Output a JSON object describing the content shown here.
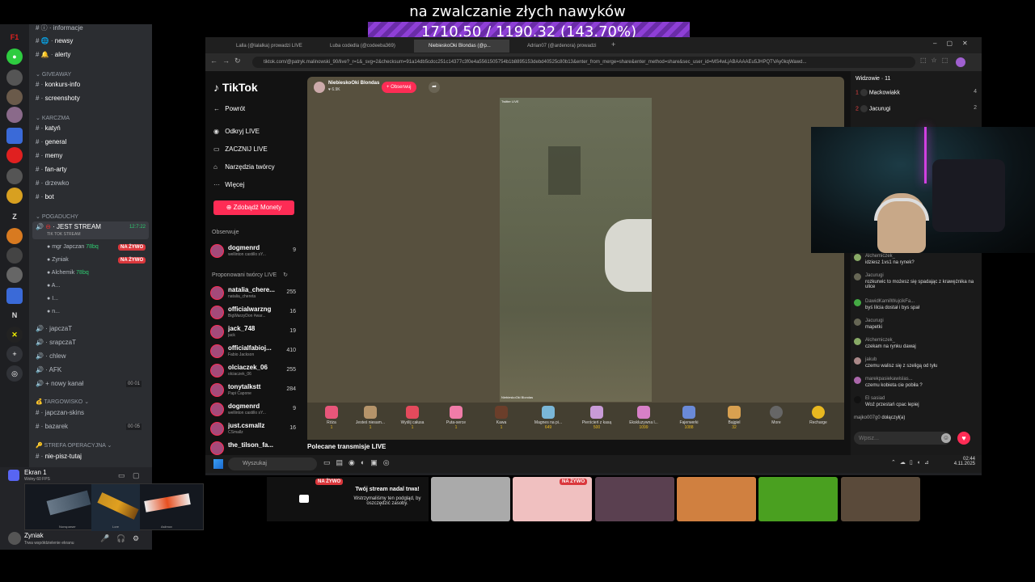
{
  "overlay": {
    "title": "na zwalczanie złych nawyków",
    "progress_text": "1710.50 / 1190.32 (143.70%)",
    "progress_percent": 143.7
  },
  "discord": {
    "channels": [
      {
        "name": "informacje",
        "icon": "info-icon"
      },
      {
        "name": "newsy",
        "icon": "globe-icon"
      },
      {
        "name": "alerty",
        "icon": "bell-icon"
      }
    ],
    "cat_giveaway": "GIVEAWAY",
    "giveaway_channels": [
      "konkurs-info",
      "screenshoty"
    ],
    "cat_karczma": "KARCZMA",
    "karczma_channels": [
      "katyń",
      "general",
      "memy",
      "fan-arty",
      "drzewko",
      "bot"
    ],
    "cat_pogaduchy": "POGADUCHY",
    "live_channel": "JEST STREAM",
    "live_channel_sub": "TIK TOK STREAM",
    "live_timer": "12:7:22",
    "live_users": [
      {
        "name": "mgr Japczan",
        "badge": "78bq",
        "live": "NA ŻYWO"
      },
      {
        "name": "Zyniak",
        "badge": "",
        "live": "NA ŻYWO"
      },
      {
        "name": "Alchemik",
        "badge": "78bq",
        "live": ""
      },
      {
        "name": "A...",
        "badge": "",
        "live": ""
      },
      {
        "name": "I...",
        "badge": "",
        "live": ""
      },
      {
        "name": "n...",
        "badge": "",
        "live": ""
      }
    ],
    "voice_channels": [
      {
        "name": "japczaT",
        "count": ""
      },
      {
        "name": "srapczaT",
        "count": ""
      },
      {
        "name": "chlew",
        "count": ""
      },
      {
        "name": "AFK",
        "count": ""
      },
      {
        "name": "nowy kanał",
        "count": "00 01"
      }
    ],
    "cat_targowisko": "TARGOWISKO",
    "targ_channels": [
      {
        "name": "japczan-skins",
        "count": ""
      },
      {
        "name": "bazarek",
        "count": "00 05"
      }
    ],
    "cat_strefa": "STREFA OPERACYJNA",
    "strefa_channels": [
      "nie-pisz-tutaj"
    ],
    "screen_share_title": "Ekran 1",
    "screen_share_sub": "Wolny 60 FPS",
    "skins": [
      "Nonsparser",
      "Lore",
      "Asiimov"
    ],
    "user_name": "Zyniak",
    "user_status": "Trwa współdzielenie ekranu",
    "server_letters": [
      "Z",
      "N"
    ]
  },
  "browser": {
    "tabs": [
      "Lalla (@lalalka) prowadzi LIVE",
      "Luba codedla (@codeeba369)",
      "NiebieskoOki Blondas (@p...",
      "Adrian07 (@ardenora) prowadzi"
    ],
    "url": "tiktok.com/@patryk.malinowski_90/live?_r=1&_svg=2&checksum=91a14db5cdcc251c14377c3f0e4a5561505754b1b8895153debd40525c80b13&enter_from_merge=share&enter_method=share&sec_user_id=MS4wLjABAAAAEu5JHPQTVAy0kqWawd..."
  },
  "tiktok": {
    "logo": "TikTok",
    "nav": [
      {
        "label": "Powrót",
        "icon": "arrow-left-icon"
      },
      {
        "label": "Odkryj LIVE",
        "icon": "live-icon"
      },
      {
        "label": "ZACZNIJ LIVE",
        "icon": "camera-icon"
      },
      {
        "label": "Narzędzia twórcy",
        "icon": "home-icon"
      },
      {
        "label": "Więcej",
        "icon": "more-icon"
      }
    ],
    "coins_button": "Zdobądź Monety",
    "following_title": "Obserwuje",
    "following": [
      {
        "name": "dogmenrd",
        "sub": "wellinton castillo sY...",
        "count": "9"
      }
    ],
    "suggested_title": "Proponowani twórcy LIVE",
    "suggested": [
      {
        "name": "natalia_chere...",
        "sub": "natalia_chereta",
        "count": "255"
      },
      {
        "name": "officialwarzng",
        "sub": "BigWarzyDon #war...",
        "count": "16"
      },
      {
        "name": "jack_748",
        "sub": "jack",
        "count": "19"
      },
      {
        "name": "officialfabioj...",
        "sub": "Fabio Jackson",
        "count": "410"
      },
      {
        "name": "olciaczek_06",
        "sub": "olciaczek_06",
        "count": "255"
      },
      {
        "name": "tonytalkstt",
        "sub": "Papi Capone",
        "count": "284"
      },
      {
        "name": "dogmenrd",
        "sub": "wellinton castillo sY...",
        "count": "9"
      },
      {
        "name": "just.csmallz",
        "sub": "CSmallz",
        "count": "16"
      },
      {
        "name": "the_tilson_fa...",
        "sub": "",
        "count": ""
      }
    ],
    "host_name": "NiebieskoOki Blondas",
    "host_likes": "6.9K",
    "follow_button": "+ Obserwuj",
    "video_tag_top": "Twitter LIVE",
    "video_tag_bottom": "NiebieskoOki Blondas",
    "gifts": [
      {
        "name": "Róża",
        "price": "1",
        "color": "#e8567a"
      },
      {
        "name": "Jesteś niesam...",
        "price": "1",
        "color": "#b5946a"
      },
      {
        "name": "Wyślij całusa",
        "price": "1",
        "color": "#e44a5c"
      },
      {
        "name": "Puta-serce",
        "price": "1",
        "color": "#f07ca8"
      },
      {
        "name": "Kawa",
        "price": "1",
        "color": "#6b3e2a"
      },
      {
        "name": "Magnes na pi...",
        "price": "649",
        "color": "#7ab7d8"
      },
      {
        "name": "Pierścień z kasą",
        "price": "500",
        "color": "#c99bd8"
      },
      {
        "name": "Ekskluzywna l...",
        "price": "1099",
        "color": "#d880c8"
      },
      {
        "name": "Fajerwerki",
        "price": "1088",
        "color": "#6a8ad8"
      },
      {
        "name": "Bajgiel",
        "price": "32",
        "color": "#d8a050"
      },
      {
        "name": "More",
        "price": "",
        "color": "#666"
      },
      {
        "name": "Recharge",
        "price": "",
        "color": "#e8b820"
      }
    ],
    "recommended_title": "Polecane transmisje LIVE",
    "viewers_title": "Widzowie · 11",
    "viewers": [
      {
        "rank": "1",
        "name": "Mackowiakk",
        "score": "4"
      },
      {
        "rank": "2",
        "name": "Jacurugi",
        "score": "2"
      }
    ],
    "chat": [
      {
        "name": "Alchemiczek_",
        "text": "idziesz 1vs1 na rynek?"
      },
      {
        "name": "Jacurugi",
        "text": "rozkurwic to możesz się spadając z krawężnika na ulice"
      },
      {
        "name": "DawidKamilWujcikFa...",
        "text": "byś lilcia dostał i bys spał"
      },
      {
        "name": "Jacurugi",
        "text": "mapetki"
      },
      {
        "name": "Alchemiczek_",
        "text": "czekam na rynku dawaj"
      },
      {
        "name": "jakub",
        "text": "czemu walisz się z szeligą od tyłu"
      },
      {
        "name": "marekpasiekawislas...",
        "text": "czemu kobieta cie pobiła ?"
      },
      {
        "name": "El sasiad",
        "text": "Woź przestań cpac lepiej"
      },
      {
        "name": "majko007g0",
        "text": "dołączył(a)"
      }
    ],
    "chat_placeholder": "Wpisz..."
  },
  "taskbar": {
    "search": "Wyszukaj",
    "time": "02:44",
    "date": "4.11.2025"
  },
  "bottom": {
    "live_badge": "NA ŻYWO",
    "paused_title": "Twój stream nadal trwa!",
    "paused_text": "Wstrzymaliśmy ten podgląd, by oszczędzić zasoby.",
    "tile_badge": "NA ŻYWO"
  }
}
